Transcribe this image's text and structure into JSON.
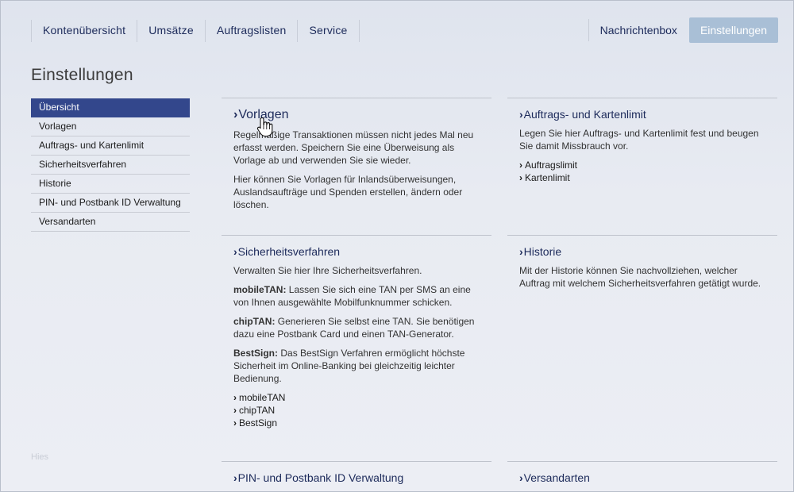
{
  "nav": {
    "items": [
      "Kontenübersicht",
      "Umsätze",
      "Auftragslisten",
      "Service"
    ],
    "messages": "Nachrichtenbox",
    "settings": "Einstellungen"
  },
  "page": {
    "title": "Einstellungen",
    "faint_text": "Hies"
  },
  "sidebar": {
    "items": [
      "Übersicht",
      "Vorlagen",
      "Auftrags- und Kartenlimit",
      "Sicherheitsverfahren",
      "Historie",
      "PIN- und Postbank ID Verwaltung",
      "Versandarten"
    ]
  },
  "panels": {
    "vorlagen": {
      "title": "Vorlagen",
      "p1": "Regelmäßige Transaktionen müssen nicht jedes Mal neu erfasst werden. Speichern Sie eine Überweisung als Vorlage ab und verwenden Sie sie wieder.",
      "p2": "Hier können Sie Vorlagen für Inlandsüberweisungen, Auslandsaufträge und Spenden erstellen, ändern oder löschen."
    },
    "limit": {
      "title": "Auftrags- und Kartenlimit",
      "p1": "Legen Sie hier Auftrags- und Kartenlimit fest und beugen Sie damit Missbrauch vor.",
      "links": [
        "Auftragslimit",
        "Kartenlimit"
      ]
    },
    "sicherheit": {
      "title": "Sicherheitsverfahren",
      "p1": "Verwalten Sie hier Ihre Sicherheitsverfahren.",
      "mobile_label": "mobileTAN:",
      "mobile_text": " Lassen Sie sich eine TAN per SMS an eine von Ihnen ausgewählte Mobilfunknummer schicken.",
      "chip_label": "chipTAN:",
      "chip_text": " Generieren Sie selbst eine TAN. Sie benötigen dazu eine Postbank Card und einen TAN-Generator.",
      "best_label": "BestSign:",
      "best_text": " Das BestSign Verfahren ermöglicht höchste Sicherheit im Online-Banking bei gleichzeitig leichter Bedienung.",
      "links": [
        "mobileTAN",
        "chipTAN",
        "BestSign"
      ]
    },
    "historie": {
      "title": "Historie",
      "p1": "Mit der Historie können Sie nachvollziehen, welcher Auftrag mit welchem Sicherheitsverfahren getätigt wurde."
    },
    "pin": {
      "title": "PIN- und Postbank ID Verwaltung"
    },
    "versand": {
      "title": "Versandarten"
    }
  },
  "caret": "›"
}
